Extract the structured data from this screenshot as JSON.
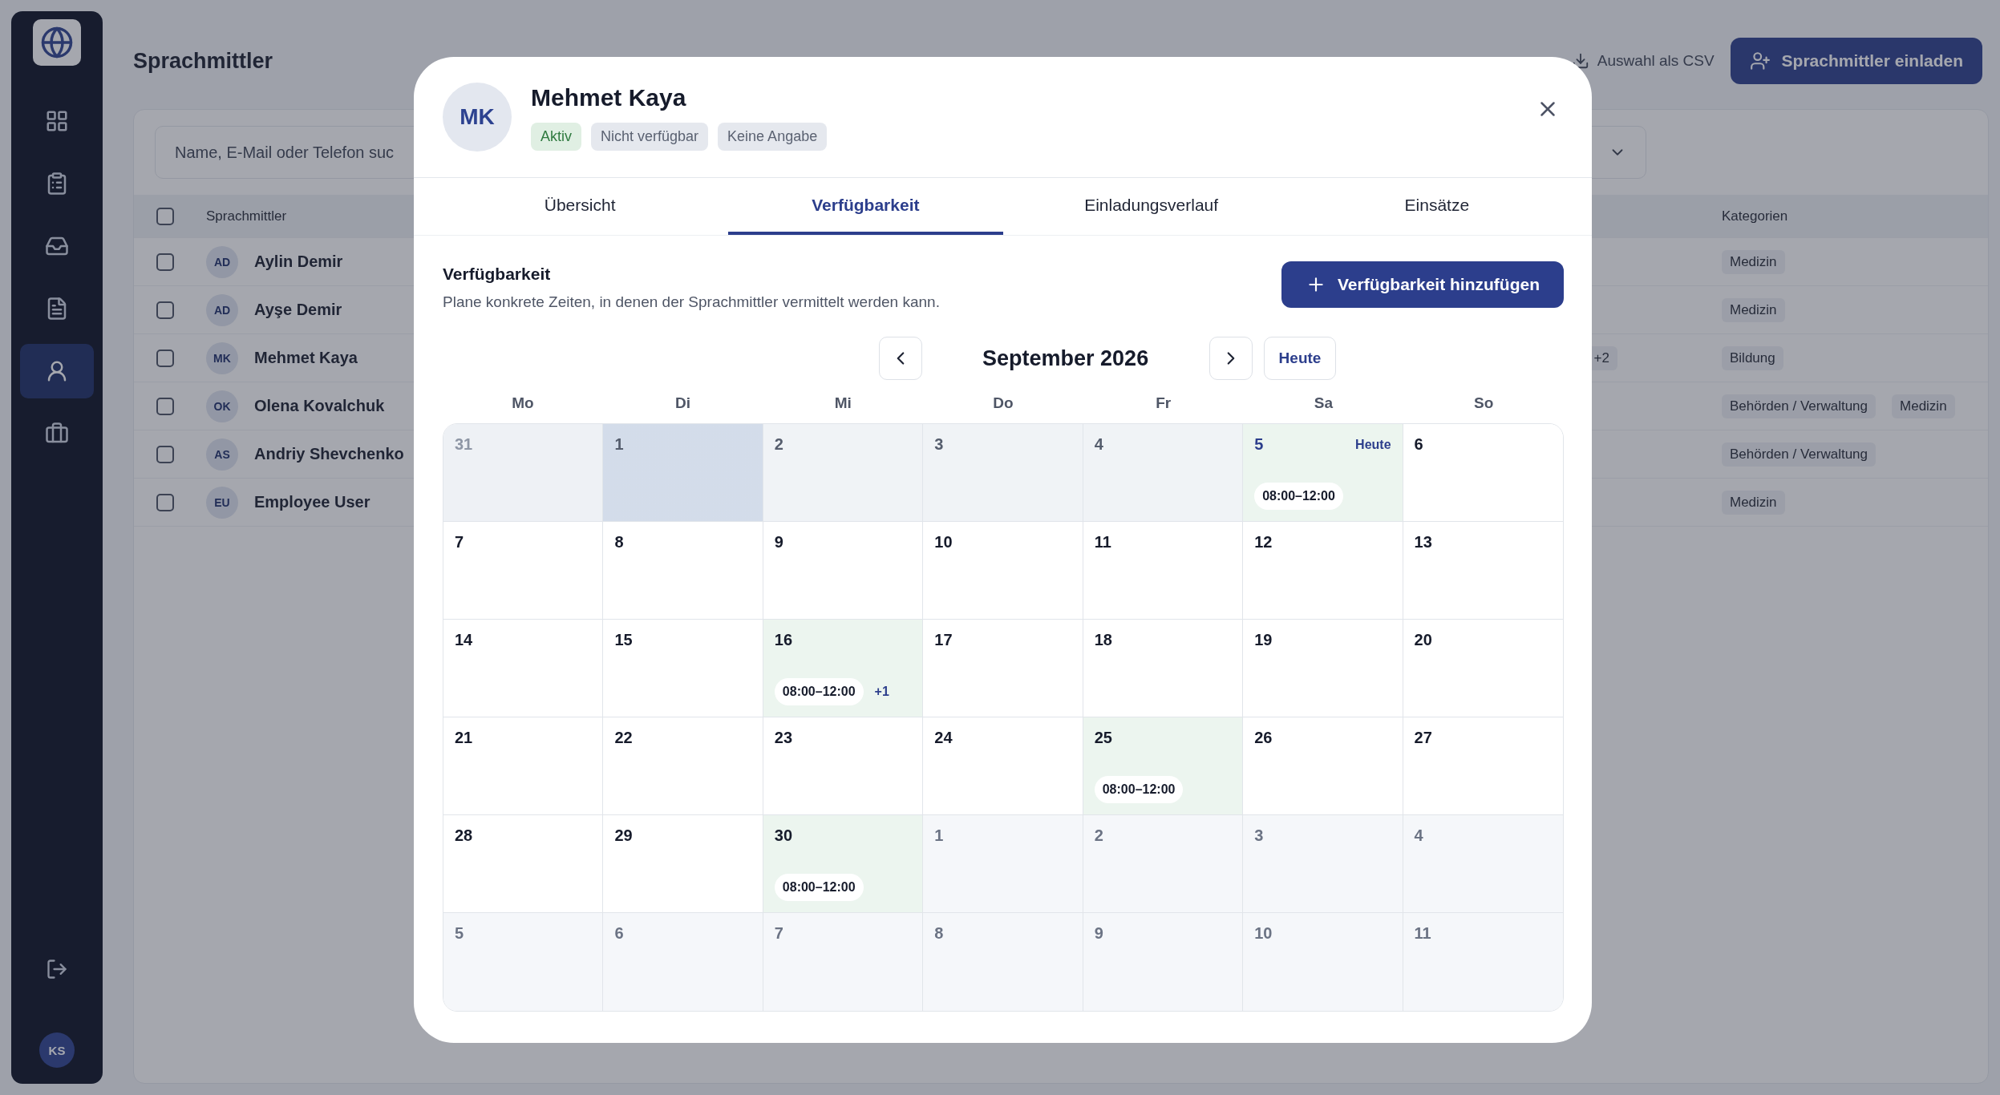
{
  "sidebar": {
    "items": [
      {
        "kind": "dashboard",
        "selected": false
      },
      {
        "kind": "clipboard",
        "selected": false
      },
      {
        "kind": "inbox",
        "selected": false
      },
      {
        "kind": "document",
        "selected": false
      },
      {
        "kind": "people",
        "selected": true
      },
      {
        "kind": "briefcase",
        "selected": false
      }
    ],
    "user": {
      "initials": "KS"
    }
  },
  "page": {
    "title": "Sprachmittler",
    "export_button": "Auswahl als CSV",
    "invite_button": "Sprachmittler einladen",
    "search": {
      "placeholder": "Name, E-Mail oder Telefon suc"
    },
    "table": {
      "columns": [
        "Sprachmittler",
        "Kategorien"
      ],
      "header_checked": false,
      "rows": [
        {
          "initials": "AD",
          "name": "Aylin Demir",
          "checked": false,
          "categories": [
            "Medizin"
          ]
        },
        {
          "initials": "AD",
          "name": "Ayşe Demir",
          "checked": false,
          "categories": [
            "Medizin"
          ]
        },
        {
          "initials": "MK",
          "name": "Mehmet Kaya",
          "checked": false,
          "column_3": "+2",
          "categories": [
            "Bildung"
          ]
        },
        {
          "initials": "OK",
          "name": "Olena Kovalchuk",
          "checked": false,
          "categories": [
            "Behörden / Verwaltung",
            "Medizin"
          ]
        },
        {
          "initials": "AS",
          "name": "Andriy Shevchenko",
          "checked": false,
          "categories": [
            "Behörden / Verwaltung"
          ]
        },
        {
          "initials": "EU",
          "name": "Employee User",
          "checked": false,
          "categories": [
            "Medizin"
          ]
        }
      ]
    }
  },
  "dialog": {
    "initials": "MK",
    "name": "Mehmet Kaya",
    "badges": [
      {
        "label": "Aktiv",
        "color": "#e0efe3"
      },
      {
        "label": "Nicht verfügbar",
        "color": "#e5e8ee"
      },
      {
        "label": "Keine Angabe",
        "color": "#e5e8ee"
      }
    ],
    "tabs": [
      {
        "label": "Übersicht",
        "selected": false
      },
      {
        "label": "Verfügbarkeit",
        "selected": true
      },
      {
        "label": "Einladungsverlauf",
        "selected": false
      },
      {
        "label": "Einsätze",
        "selected": false
      }
    ],
    "section_title": "Verfügbarkeit",
    "section_description": "Plane konkrete Zeiten, in denen der Sprachmittler vermittelt werden kann.",
    "add_button": "Verfügbarkeit hinzufügen",
    "calendar": {
      "month": "September 2026",
      "today_button": "Heute",
      "weekdays": [
        "Mo",
        "Di",
        "Mi",
        "Do",
        "Fr",
        "Sa",
        "So"
      ],
      "weeks": [
        [
          {
            "day": "31",
            "kind": "previous",
            "selected": false
          },
          {
            "day": "1",
            "kind": "past",
            "selected": true
          },
          {
            "day": "2",
            "kind": "past",
            "selected": false
          },
          {
            "day": "3",
            "kind": "past",
            "selected": false
          },
          {
            "day": "4",
            "kind": "past",
            "selected": false
          },
          {
            "day": "5",
            "kind": "today",
            "selected": false,
            "today_label": "Heute",
            "slots": [
              "08:00–12:00"
            ]
          },
          {
            "day": "6",
            "kind": "current",
            "selected": false
          }
        ],
        [
          {
            "day": "7",
            "kind": "current",
            "selected": false
          },
          {
            "day": "8",
            "kind": "current",
            "selected": false
          },
          {
            "day": "9",
            "kind": "current",
            "selected": false
          },
          {
            "day": "10",
            "kind": "current",
            "selected": false
          },
          {
            "day": "11",
            "kind": "current",
            "selected": false
          },
          {
            "day": "12",
            "kind": "current",
            "selected": false
          },
          {
            "day": "13",
            "kind": "current",
            "selected": false
          }
        ],
        [
          {
            "day": "14",
            "kind": "current",
            "selected": false
          },
          {
            "day": "15",
            "kind": "current",
            "selected": false
          },
          {
            "day": "16",
            "kind": "available",
            "selected": false,
            "slots": [
              "08:00–12:00"
            ],
            "more": "+1"
          },
          {
            "day": "17",
            "kind": "current",
            "selected": false
          },
          {
            "day": "18",
            "kind": "current",
            "selected": false
          },
          {
            "day": "19",
            "kind": "current",
            "selected": false
          },
          {
            "day": "20",
            "kind": "current",
            "selected": false
          }
        ],
        [
          {
            "day": "21",
            "kind": "current",
            "selected": false
          },
          {
            "day": "22",
            "kind": "current",
            "selected": false
          },
          {
            "day": "23",
            "kind": "current",
            "selected": false
          },
          {
            "day": "24",
            "kind": "current",
            "selected": false
          },
          {
            "day": "25",
            "kind": "available",
            "selected": false,
            "slots": [
              "08:00–12:00"
            ]
          },
          {
            "day": "26",
            "kind": "current",
            "selected": false
          },
          {
            "day": "27",
            "kind": "current",
            "selected": false
          }
        ],
        [
          {
            "day": "28",
            "kind": "current",
            "selected": false
          },
          {
            "day": "29",
            "kind": "current",
            "selected": false
          },
          {
            "day": "30",
            "kind": "available",
            "selected": false,
            "slots": [
              "08:00–12:00"
            ]
          },
          {
            "day": "1",
            "kind": "next",
            "selected": false
          },
          {
            "day": "2",
            "kind": "next",
            "selected": false
          },
          {
            "day": "3",
            "kind": "next",
            "selected": false
          },
          {
            "day": "4",
            "kind": "next",
            "selected": false
          }
        ],
        [
          {
            "day": "5",
            "kind": "next",
            "selected": false
          },
          {
            "day": "6",
            "kind": "next",
            "selected": false
          },
          {
            "day": "7",
            "kind": "next",
            "selected": false
          },
          {
            "day": "8",
            "kind": "next",
            "selected": false
          },
          {
            "day": "9",
            "kind": "next",
            "selected": false
          },
          {
            "day": "10",
            "kind": "next",
            "selected": false
          },
          {
            "day": "11",
            "kind": "next",
            "selected": false
          }
        ]
      ]
    }
  }
}
